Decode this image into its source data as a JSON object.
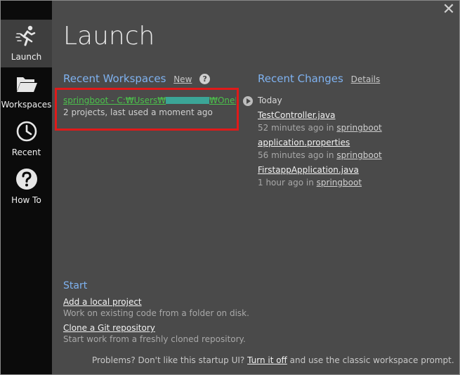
{
  "sidebar": {
    "items": [
      {
        "label": "Launch",
        "icon": "runner-icon",
        "active": true
      },
      {
        "label": "Workspaces",
        "icon": "folder-icon",
        "active": false
      },
      {
        "label": "Recent",
        "icon": "clock-icon",
        "active": false
      },
      {
        "label": "How To",
        "icon": "question-icon",
        "active": false
      }
    ]
  },
  "close": {
    "glyph": "✕"
  },
  "page": {
    "title": "Launch"
  },
  "recent_workspaces": {
    "heading": "Recent Workspaces",
    "new_label": "New",
    "help_glyph": "?",
    "items": [
      {
        "name_prefix": "springboot - C:₩Users₩",
        "name_suffix": "₩OneD...",
        "meta": "2 projects, last used a moment ago"
      }
    ]
  },
  "recent_changes": {
    "heading": "Recent Changes",
    "details_label": "Details",
    "group": "Today",
    "items": [
      {
        "file": "TestController.java",
        "time": "52 minutes ago in",
        "project": "springboot"
      },
      {
        "file": "application.properties",
        "time": "56 minutes ago in",
        "project": "springboot"
      },
      {
        "file": "FirstappApplication.java",
        "time": "1 hour ago in",
        "project": "springboot"
      }
    ]
  },
  "start": {
    "heading": "Start",
    "items": [
      {
        "link": "Add a local project",
        "desc": "Work on existing code from a folder on disk."
      },
      {
        "link": "Clone a Git repository",
        "desc": "Start work from a freshly cloned repository."
      }
    ]
  },
  "footer": {
    "prefix": "Problems? Don't like this startup UI?",
    "link": "Turn it off",
    "suffix": "and use the classic workspace prompt."
  },
  "colors": {
    "sidebar_bg": "#0b0b0b",
    "main_bg": "#4a4a4a",
    "accent_heading": "#7fb2f0",
    "workspace_link": "#4cc24c",
    "highlight_border": "#e01a1a"
  }
}
